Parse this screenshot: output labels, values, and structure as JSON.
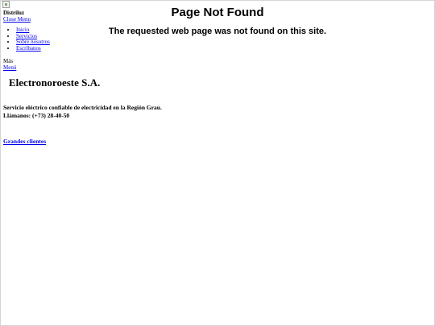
{
  "site": {
    "brand": "Distriluz",
    "close_menu": "Close Menu",
    "nav": [
      "Inicio",
      "Servicios",
      "Sobre nosotros",
      "Escríbanos"
    ],
    "more_label": "Más",
    "menu_link": "Menú"
  },
  "error": {
    "title": "Page Not Found",
    "message": "The requested web page was not found on this site."
  },
  "company": {
    "name": "Electronoroeste S.A.",
    "tagline": "Servicio eléctrico confiable de electricidad en la Región Grau.",
    "phone": "Llámanos: (+73) 28-40-50"
  },
  "links": {
    "clients": "Grandes clientes"
  }
}
